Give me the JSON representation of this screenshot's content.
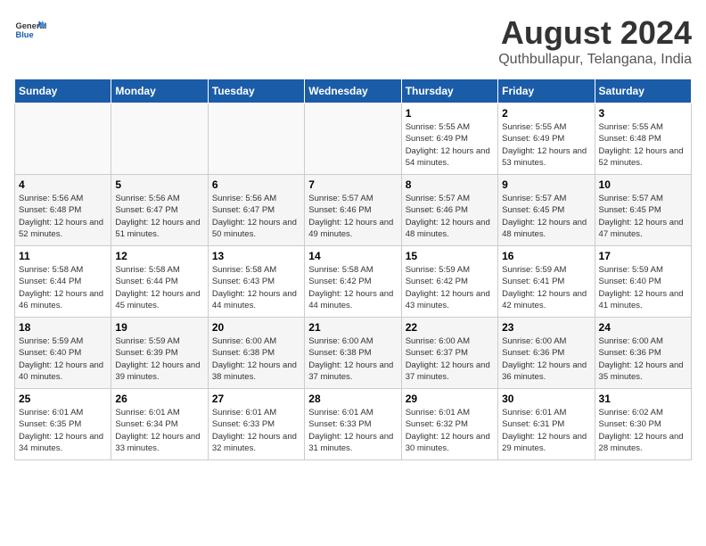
{
  "logo": {
    "line1": "General",
    "line2": "Blue"
  },
  "title": "August 2024",
  "subtitle": "Quthbullapur, Telangana, India",
  "days_of_week": [
    "Sunday",
    "Monday",
    "Tuesday",
    "Wednesday",
    "Thursday",
    "Friday",
    "Saturday"
  ],
  "weeks": [
    [
      {
        "day": "",
        "sunrise": "",
        "sunset": "",
        "daylight": ""
      },
      {
        "day": "",
        "sunrise": "",
        "sunset": "",
        "daylight": ""
      },
      {
        "day": "",
        "sunrise": "",
        "sunset": "",
        "daylight": ""
      },
      {
        "day": "",
        "sunrise": "",
        "sunset": "",
        "daylight": ""
      },
      {
        "day": "1",
        "sunrise": "Sunrise: 5:55 AM",
        "sunset": "Sunset: 6:49 PM",
        "daylight": "Daylight: 12 hours and 54 minutes."
      },
      {
        "day": "2",
        "sunrise": "Sunrise: 5:55 AM",
        "sunset": "Sunset: 6:49 PM",
        "daylight": "Daylight: 12 hours and 53 minutes."
      },
      {
        "day": "3",
        "sunrise": "Sunrise: 5:55 AM",
        "sunset": "Sunset: 6:48 PM",
        "daylight": "Daylight: 12 hours and 52 minutes."
      }
    ],
    [
      {
        "day": "4",
        "sunrise": "Sunrise: 5:56 AM",
        "sunset": "Sunset: 6:48 PM",
        "daylight": "Daylight: 12 hours and 52 minutes."
      },
      {
        "day": "5",
        "sunrise": "Sunrise: 5:56 AM",
        "sunset": "Sunset: 6:47 PM",
        "daylight": "Daylight: 12 hours and 51 minutes."
      },
      {
        "day": "6",
        "sunrise": "Sunrise: 5:56 AM",
        "sunset": "Sunset: 6:47 PM",
        "daylight": "Daylight: 12 hours and 50 minutes."
      },
      {
        "day": "7",
        "sunrise": "Sunrise: 5:57 AM",
        "sunset": "Sunset: 6:46 PM",
        "daylight": "Daylight: 12 hours and 49 minutes."
      },
      {
        "day": "8",
        "sunrise": "Sunrise: 5:57 AM",
        "sunset": "Sunset: 6:46 PM",
        "daylight": "Daylight: 12 hours and 48 minutes."
      },
      {
        "day": "9",
        "sunrise": "Sunrise: 5:57 AM",
        "sunset": "Sunset: 6:45 PM",
        "daylight": "Daylight: 12 hours and 48 minutes."
      },
      {
        "day": "10",
        "sunrise": "Sunrise: 5:57 AM",
        "sunset": "Sunset: 6:45 PM",
        "daylight": "Daylight: 12 hours and 47 minutes."
      }
    ],
    [
      {
        "day": "11",
        "sunrise": "Sunrise: 5:58 AM",
        "sunset": "Sunset: 6:44 PM",
        "daylight": "Daylight: 12 hours and 46 minutes."
      },
      {
        "day": "12",
        "sunrise": "Sunrise: 5:58 AM",
        "sunset": "Sunset: 6:44 PM",
        "daylight": "Daylight: 12 hours and 45 minutes."
      },
      {
        "day": "13",
        "sunrise": "Sunrise: 5:58 AM",
        "sunset": "Sunset: 6:43 PM",
        "daylight": "Daylight: 12 hours and 44 minutes."
      },
      {
        "day": "14",
        "sunrise": "Sunrise: 5:58 AM",
        "sunset": "Sunset: 6:42 PM",
        "daylight": "Daylight: 12 hours and 44 minutes."
      },
      {
        "day": "15",
        "sunrise": "Sunrise: 5:59 AM",
        "sunset": "Sunset: 6:42 PM",
        "daylight": "Daylight: 12 hours and 43 minutes."
      },
      {
        "day": "16",
        "sunrise": "Sunrise: 5:59 AM",
        "sunset": "Sunset: 6:41 PM",
        "daylight": "Daylight: 12 hours and 42 minutes."
      },
      {
        "day": "17",
        "sunrise": "Sunrise: 5:59 AM",
        "sunset": "Sunset: 6:40 PM",
        "daylight": "Daylight: 12 hours and 41 minutes."
      }
    ],
    [
      {
        "day": "18",
        "sunrise": "Sunrise: 5:59 AM",
        "sunset": "Sunset: 6:40 PM",
        "daylight": "Daylight: 12 hours and 40 minutes."
      },
      {
        "day": "19",
        "sunrise": "Sunrise: 5:59 AM",
        "sunset": "Sunset: 6:39 PM",
        "daylight": "Daylight: 12 hours and 39 minutes."
      },
      {
        "day": "20",
        "sunrise": "Sunrise: 6:00 AM",
        "sunset": "Sunset: 6:38 PM",
        "daylight": "Daylight: 12 hours and 38 minutes."
      },
      {
        "day": "21",
        "sunrise": "Sunrise: 6:00 AM",
        "sunset": "Sunset: 6:38 PM",
        "daylight": "Daylight: 12 hours and 37 minutes."
      },
      {
        "day": "22",
        "sunrise": "Sunrise: 6:00 AM",
        "sunset": "Sunset: 6:37 PM",
        "daylight": "Daylight: 12 hours and 37 minutes."
      },
      {
        "day": "23",
        "sunrise": "Sunrise: 6:00 AM",
        "sunset": "Sunset: 6:36 PM",
        "daylight": "Daylight: 12 hours and 36 minutes."
      },
      {
        "day": "24",
        "sunrise": "Sunrise: 6:00 AM",
        "sunset": "Sunset: 6:36 PM",
        "daylight": "Daylight: 12 hours and 35 minutes."
      }
    ],
    [
      {
        "day": "25",
        "sunrise": "Sunrise: 6:01 AM",
        "sunset": "Sunset: 6:35 PM",
        "daylight": "Daylight: 12 hours and 34 minutes."
      },
      {
        "day": "26",
        "sunrise": "Sunrise: 6:01 AM",
        "sunset": "Sunset: 6:34 PM",
        "daylight": "Daylight: 12 hours and 33 minutes."
      },
      {
        "day": "27",
        "sunrise": "Sunrise: 6:01 AM",
        "sunset": "Sunset: 6:33 PM",
        "daylight": "Daylight: 12 hours and 32 minutes."
      },
      {
        "day": "28",
        "sunrise": "Sunrise: 6:01 AM",
        "sunset": "Sunset: 6:33 PM",
        "daylight": "Daylight: 12 hours and 31 minutes."
      },
      {
        "day": "29",
        "sunrise": "Sunrise: 6:01 AM",
        "sunset": "Sunset: 6:32 PM",
        "daylight": "Daylight: 12 hours and 30 minutes."
      },
      {
        "day": "30",
        "sunrise": "Sunrise: 6:01 AM",
        "sunset": "Sunset: 6:31 PM",
        "daylight": "Daylight: 12 hours and 29 minutes."
      },
      {
        "day": "31",
        "sunrise": "Sunrise: 6:02 AM",
        "sunset": "Sunset: 6:30 PM",
        "daylight": "Daylight: 12 hours and 28 minutes."
      }
    ]
  ]
}
